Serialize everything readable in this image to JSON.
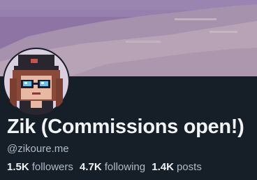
{
  "profile": {
    "display_name": "Zik (Commissions open!)",
    "handle": "@zikoure.me",
    "avatar_icon": "avatar-pixel-art-character",
    "banner_icon": "pixel-art-mountain-landscape",
    "stats": {
      "followers": {
        "count": "1.5K",
        "label": "followers"
      },
      "following": {
        "count": "4.7K",
        "label": "following"
      },
      "posts": {
        "count": "1.4K",
        "label": "posts"
      }
    }
  },
  "colors": {
    "background": "#161e27",
    "name": "#f1f3f5",
    "secondary_text": "#aebbc9",
    "banner_sky": "#8e74a4",
    "banner_mountain": "#b2a0b0"
  }
}
